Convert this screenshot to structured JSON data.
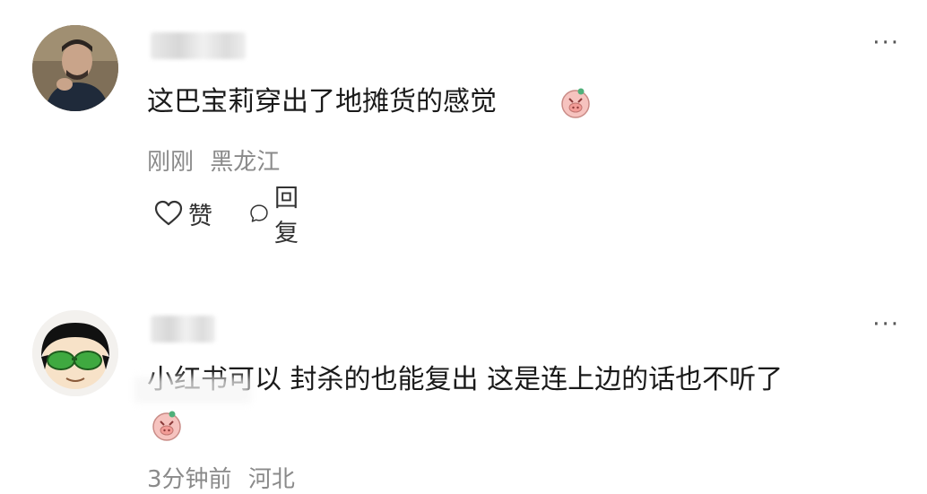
{
  "comments": [
    {
      "text": "这巴宝莉穿出了地摊货的感觉",
      "time": "刚刚",
      "location": "黑龙江",
      "like_label": "赞",
      "reply_label": "回复",
      "more_label": "···"
    },
    {
      "text": "小红书可以 封杀的也能复出 这是连上边的话也不听了",
      "time": "3分钟前",
      "location": "河北",
      "more_label": "···"
    }
  ],
  "icons": {
    "emoji": "piggy-emoji-icon",
    "like": "heart-icon",
    "reply": "speech-bubble-icon"
  },
  "colors": {
    "text": "#1a1a1a",
    "meta": "#8a8a8a",
    "emoji_pink": "#f4b7b3"
  }
}
